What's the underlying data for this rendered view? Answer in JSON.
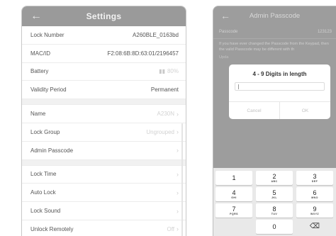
{
  "settings": {
    "title": "Settings",
    "groups": [
      [
        {
          "label": "Lock Number",
          "value": "A260BLE_0163bd"
        },
        {
          "label": "MAC/ID",
          "value": "F2:08:6B:8D:63:01/2196457"
        },
        {
          "label": "Battery",
          "value": "80%",
          "icon": "battery-icon"
        },
        {
          "label": "Validity Period",
          "value": "Permanent"
        }
      ],
      [
        {
          "label": "Name",
          "value": "A230N"
        },
        {
          "label": "Lock Group",
          "value": "Ungrouped"
        },
        {
          "label": "Admin Passcode",
          "value": ""
        }
      ],
      [
        {
          "label": "Lock Time",
          "value": ""
        },
        {
          "label": "Auto Lock",
          "value": ""
        },
        {
          "label": "Lock Sound",
          "value": ""
        },
        {
          "label": "Unlock Remotely",
          "value": "Off"
        }
      ]
    ]
  },
  "admin_passcode": {
    "title": "Admin Passcode",
    "passcode_label": "Passcode",
    "passcode_value": "123123",
    "note": "If you have ever changed the Passcode from the Keypad, then the valid Passcode may be different with th",
    "note_tail": "Upda",
    "dialog": {
      "title": "4 - 9 Digits in length",
      "input_value": "",
      "cancel_label": "Cancel",
      "ok_label": "OK"
    },
    "keypad": [
      {
        "digit": "1",
        "letters": ""
      },
      {
        "digit": "2",
        "letters": "ABC"
      },
      {
        "digit": "3",
        "letters": "DEF"
      },
      {
        "digit": "4",
        "letters": "GHI"
      },
      {
        "digit": "5",
        "letters": "JKL"
      },
      {
        "digit": "6",
        "letters": "MNO"
      },
      {
        "digit": "7",
        "letters": "PQRS"
      },
      {
        "digit": "8",
        "letters": "TUV"
      },
      {
        "digit": "9",
        "letters": "WXYZ"
      },
      {
        "digit": "",
        "letters": ""
      },
      {
        "digit": "0",
        "letters": ""
      },
      {
        "digit": "",
        "letters": "",
        "icon": "backspace-icon"
      }
    ]
  },
  "colors": {
    "header_gray": "#9a9a9a",
    "overlay_gray": "#9d9d9d",
    "keypad_bg": "#e9e9e9"
  }
}
